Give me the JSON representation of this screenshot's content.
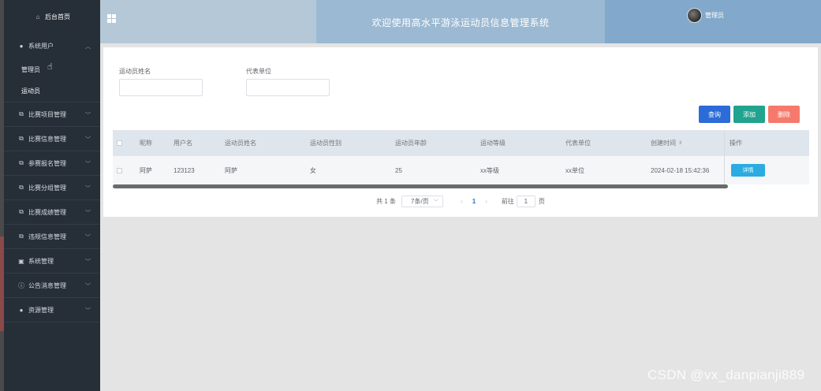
{
  "sidebar": {
    "home": "后台首页",
    "items": [
      {
        "label": "系统用户",
        "icon": "user-icon",
        "expanded": true,
        "children": [
          {
            "label": "管理员"
          },
          {
            "label": "运动员"
          }
        ]
      },
      {
        "label": "比赛项目管理",
        "icon": "external-link-icon"
      },
      {
        "label": "比赛信息管理",
        "icon": "external-link-icon"
      },
      {
        "label": "参赛报名管理",
        "icon": "external-link-icon"
      },
      {
        "label": "比赛分组管理",
        "icon": "external-link-icon"
      },
      {
        "label": "比赛成绩管理",
        "icon": "external-link-icon"
      },
      {
        "label": "违规信息管理",
        "icon": "external-link-icon"
      },
      {
        "label": "系统管理",
        "icon": "image-icon"
      },
      {
        "label": "公告消息管理",
        "icon": "info-circle-icon"
      },
      {
        "label": "资源管理",
        "icon": "location-pin-icon"
      }
    ]
  },
  "header": {
    "title": "欢迎使用高水平游泳运动员信息管理系统",
    "user": "管理员"
  },
  "search": {
    "name_label": "运动员姓名",
    "name_value": "",
    "unit_label": "代表单位",
    "unit_value": "",
    "btn_search": "查询",
    "btn_add": "添加",
    "btn_delete": "删除"
  },
  "table": {
    "columns": [
      "昵称",
      "用户名",
      "运动员姓名",
      "运动员性别",
      "运动员年龄",
      "运动等级",
      "代表单位",
      "创建时间",
      "操作"
    ],
    "rows": [
      {
        "nickname": "阿萨",
        "username": "123123",
        "name": "阿萨",
        "gender": "女",
        "age": "25",
        "level": "xx等级",
        "unit": "xx单位",
        "created": "2024-02-18 15:42:36",
        "action": "详情"
      }
    ]
  },
  "pagination": {
    "total": "共 1 条",
    "page_size": "7条/页",
    "current": "1",
    "goto_label": "前往",
    "goto_value": "1",
    "goto_suffix": "页"
  },
  "watermark": "CSDN @vx_danpianji889",
  "colors": {
    "sidebar_bg": "#262e38",
    "primary": "#2b6cd8",
    "success": "#21a38f",
    "danger": "#f57a6c",
    "info": "#2aace0"
  }
}
